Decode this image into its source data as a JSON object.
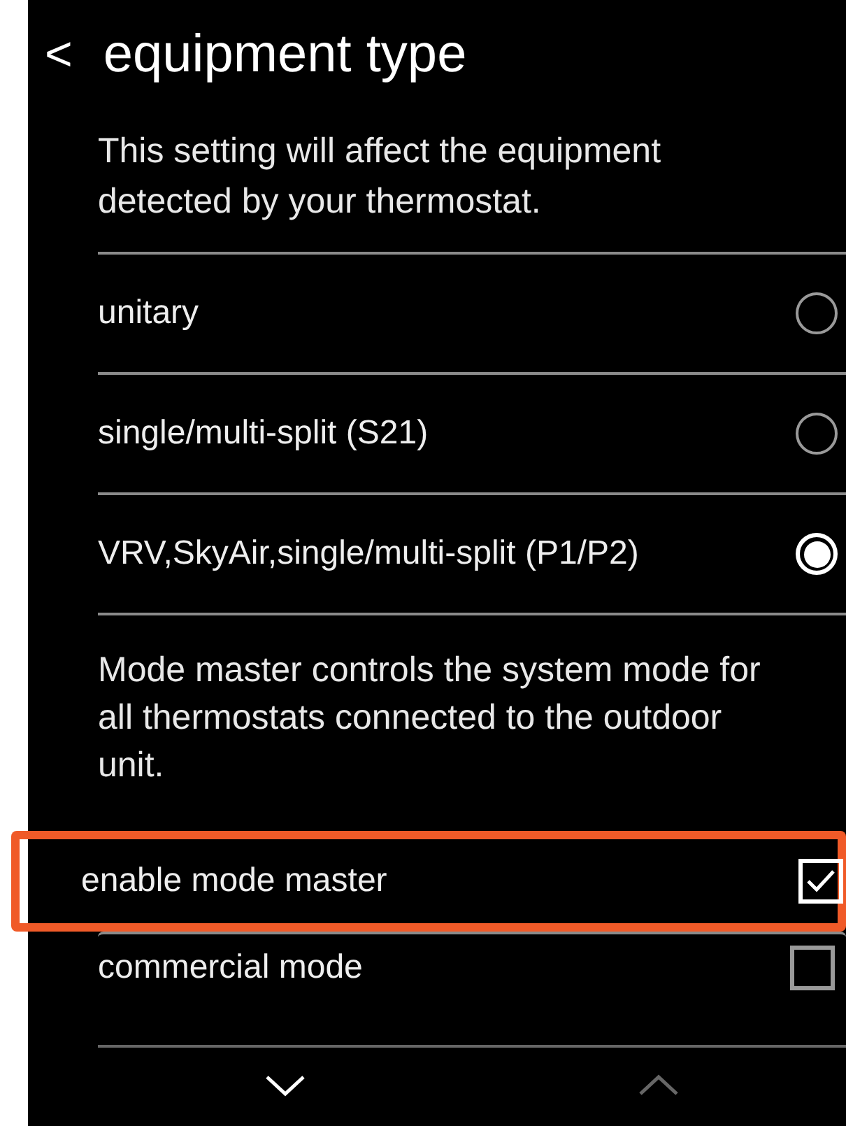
{
  "header": {
    "back": "<",
    "title": "equipment type"
  },
  "description": "This setting will affect the equipment detected by your thermostat.",
  "options": [
    {
      "label": "unitary",
      "selected": false
    },
    {
      "label": "single/multi-split (S21)",
      "selected": false
    },
    {
      "label": "VRV,SkyAir,single/multi-split (P1/P2)",
      "selected": true
    }
  ],
  "note": "Mode master controls the system mode for all thermostats connected to the outdoor unit.",
  "toggles": [
    {
      "label": "enable mode master",
      "checked": true,
      "highlighted": true
    },
    {
      "label": "commercial mode",
      "checked": false,
      "highlighted": false
    }
  ],
  "footer": [
    {
      "kind": "down",
      "disabled": false
    },
    {
      "kind": "up",
      "disabled": true
    }
  ]
}
